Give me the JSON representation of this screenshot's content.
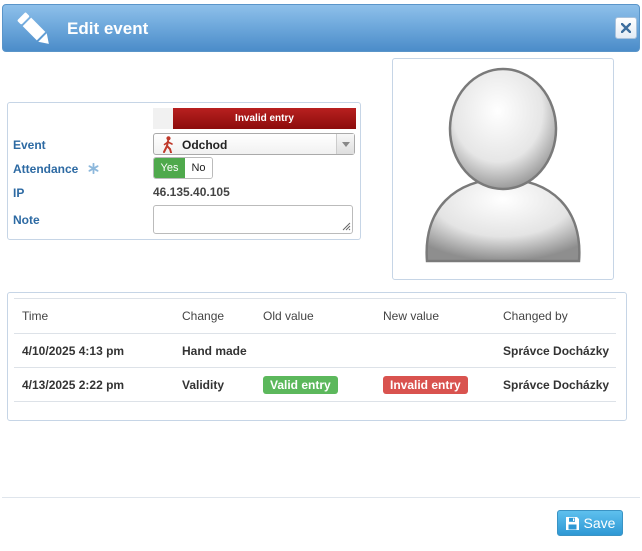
{
  "dialog": {
    "title": "Edit event",
    "title_icon": "pencil-icon",
    "close_icon": "close-icon"
  },
  "form": {
    "validity_label": "Invalid entry",
    "event_label": "Event",
    "event_value": "Odchod",
    "event_icon": "walking-person-icon",
    "attendance_label": "Attendance",
    "attendance_icon": "asterisk-icon",
    "attendance_yes": "Yes",
    "attendance_no": "No",
    "attendance_selected": "Yes",
    "ip_label": "IP",
    "ip_value": "46.135.40.105",
    "note_label": "Note",
    "note_value": ""
  },
  "photo": {
    "icon": "user-avatar-icon"
  },
  "history": {
    "columns": [
      "Time",
      "Change",
      "Old value",
      "New value",
      "Changed by"
    ],
    "rows": [
      {
        "time": "4/10/2025 4:13 pm",
        "change": "Hand made",
        "old": "",
        "new": "",
        "by": "Správce Docházky"
      },
      {
        "time": "4/13/2025 2:22 pm",
        "change": "Validity",
        "old": "Valid entry",
        "new": "Invalid entry",
        "by": "Správce Docházky"
      }
    ]
  },
  "footer": {
    "save_label": "Save",
    "save_icon": "floppy-disk-icon"
  },
  "colors": {
    "title_bar": "#4b8cc9",
    "label_blue": "#2d6aa3",
    "invalid_red": "#8c0c0c",
    "valid_green": "#5cb85c",
    "toggle_green": "#4fa94c",
    "save_button": "#2e98d4"
  }
}
